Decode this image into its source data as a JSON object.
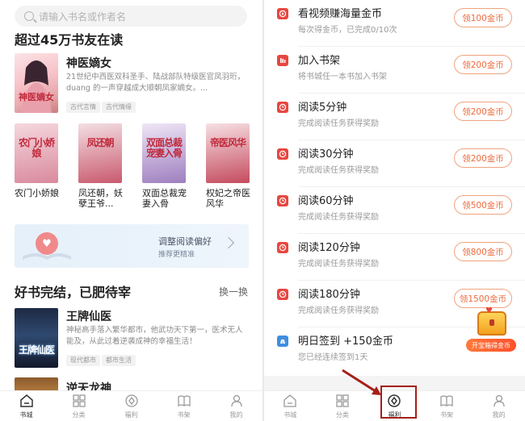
{
  "left": {
    "search": {
      "placeholder": "请输入书名或作者名"
    },
    "section1_title": "超过45万书友在读",
    "featured": {
      "title": "神医嫡女",
      "desc": "21世纪中西医双科圣手、陆战部队特级医官凤羽珩，duang 的一声穿越成大顺朝凤家嫡女。...",
      "tags": [
        "古代言情",
        "古代情缘"
      ],
      "cover_text": "神医嫡女"
    },
    "books": [
      {
        "title": "农门小娇娘",
        "cover_text": "农门小娇娘",
        "color_a": "#f5d7de",
        "color_b": "#d98a9c"
      },
      {
        "title": "凤还朝，妖孽王爷...",
        "cover_text": "凤还朝",
        "color_a": "#f3dfe4",
        "color_b": "#c95a6e"
      },
      {
        "title": "双面总裁宠妻入骨",
        "cover_text": "双面总裁宠妻入骨",
        "color_a": "#efe6f6",
        "color_b": "#9e7fbf"
      },
      {
        "title": "权妃之帝医风华",
        "cover_text": "帝医风华",
        "color_a": "#f7e0e3",
        "color_b": "#c44b5e"
      }
    ],
    "banner": {
      "title": "调整阅读偏好",
      "subtitle": "推荐更精准"
    },
    "section2_title": "好书完结，已肥待宰",
    "section2_more": "换一换",
    "rec1": {
      "title": "王牌仙医",
      "desc": "神秘高手落入繁华都市，他武功天下第一，医术无人能及，从此过着逆袭成神的幸福生活！",
      "tags": [
        "现代都市",
        "都市生活"
      ],
      "cover_text": "王牌仙医"
    },
    "rec2": {
      "title": "逆天龙神"
    }
  },
  "right": {
    "tasks": [
      {
        "icon": "video-icon",
        "title": "看视频赚海量金币",
        "sub": "每次得金币，已完成0/10次",
        "button": "领100金币"
      },
      {
        "icon": "bookshelf-icon",
        "title": "加入书架",
        "sub": "将书城任一本书加入书架",
        "button": "领200金币"
      },
      {
        "icon": "clock-icon",
        "title": "阅读5分钟",
        "sub": "完成阅读任务获得奖励",
        "button": "领200金币"
      },
      {
        "icon": "clock-icon",
        "title": "阅读30分钟",
        "sub": "完成阅读任务获得奖励",
        "button": "领200金币"
      },
      {
        "icon": "clock-icon",
        "title": "阅读60分钟",
        "sub": "完成阅读任务获得奖励",
        "button": "领500金币"
      },
      {
        "icon": "clock-icon",
        "title": "阅读120分钟",
        "sub": "完成阅读任务获得奖励",
        "button": "领800金币"
      },
      {
        "icon": "clock-icon",
        "title": "阅读180分钟",
        "sub": "完成阅读任务获得奖励",
        "button": "领1500金币"
      },
      {
        "icon": "money-bag-icon",
        "title": "明日签到 +150金币",
        "sub": "您已经连续签到1天",
        "button": ""
      }
    ],
    "treasure_label": "开宝箱得金币"
  },
  "tabbar": {
    "items": [
      {
        "icon": "home-icon",
        "label": "书城"
      },
      {
        "icon": "grid-icon",
        "label": "分类"
      },
      {
        "icon": "welfare-icon",
        "label": "福利"
      },
      {
        "icon": "book-icon",
        "label": "书架"
      },
      {
        "icon": "user-icon",
        "label": "我的"
      }
    ],
    "left_active": "书城",
    "right_active": "福利"
  },
  "colors": {
    "accent": "#ec6a3c",
    "task_icon_red": "#e8463f",
    "highlight_box": "#a5201a"
  }
}
